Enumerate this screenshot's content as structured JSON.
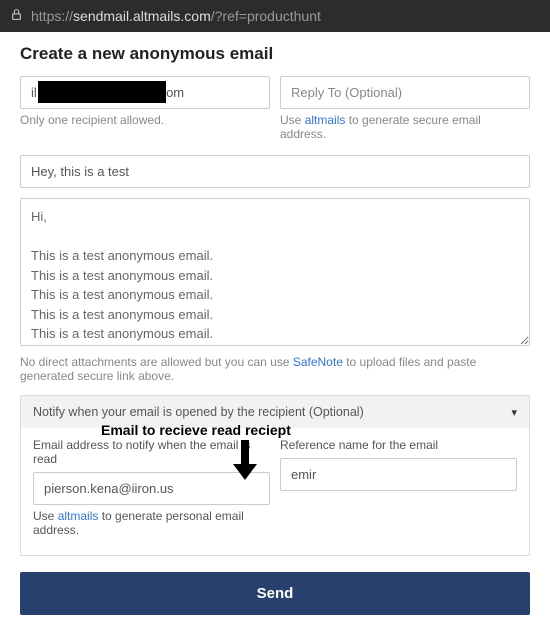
{
  "address_bar": {
    "url_prefix": "https://",
    "url_main": "sendmail.altmails.com",
    "url_suffix": "/?ref=producthunt"
  },
  "page": {
    "title": "Create a new anonymous email"
  },
  "to": {
    "value_prefix": "il",
    "value_suffix": "com",
    "helper": "Only one recipient allowed."
  },
  "reply_to": {
    "placeholder": "Reply To (Optional)",
    "helper_pre": "Use ",
    "helper_link": "altmails",
    "helper_post": " to generate secure email address."
  },
  "subject": {
    "value": "Hey, this is a test"
  },
  "body": {
    "value": "Hi,\n\nThis is a test anonymous email.\nThis is a test anonymous email.\nThis is a test anonymous email.\nThis is a test anonymous email.\nThis is a test anonymous email.\nThis is a test anonymous email.\n\nThanks"
  },
  "attachments": {
    "pre": "No direct attachments are allowed but you can use ",
    "link": "SafeNote",
    "post": " to upload files and paste generated secure link above."
  },
  "notify": {
    "header": "Notify when your email is opened by the recipient (Optional)",
    "annotation": "Email to recieve read reciept",
    "email_label": "Email address to notify when the email is read",
    "email_value": "pierson.kena@iiron.us",
    "email_helper_pre": "Use ",
    "email_helper_link": "altmails",
    "email_helper_post": " to generate personal email address.",
    "ref_label": "Reference name for the email",
    "ref_value": "emir"
  },
  "send": {
    "label": "Send"
  }
}
